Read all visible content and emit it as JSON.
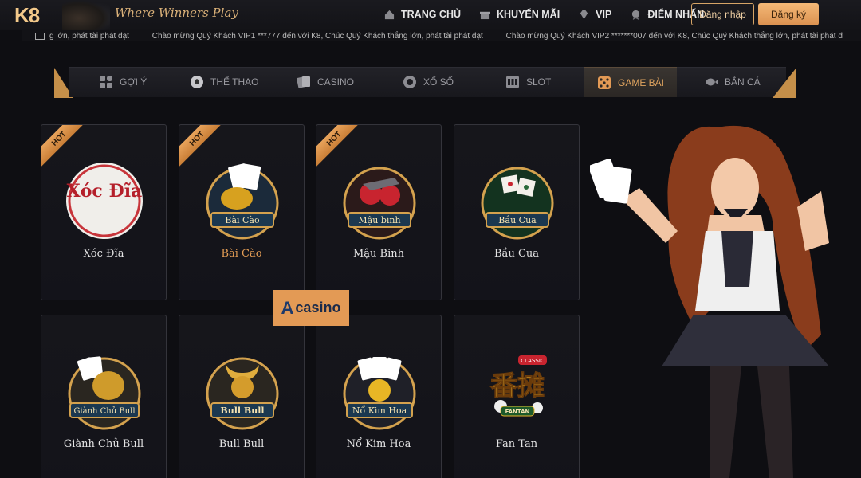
{
  "header": {
    "logo": "K8",
    "tagline": "Where Winners Play",
    "nav": [
      {
        "label": "TRANG CHỦ",
        "icon": "home-icon"
      },
      {
        "label": "KHUYẾN MÃI",
        "icon": "gift-icon"
      },
      {
        "label": "VIP",
        "icon": "diamond-icon"
      },
      {
        "label": "ĐIỂM NHẤN",
        "icon": "medal-icon"
      }
    ],
    "login_label": "Đăng nhập",
    "register_label": "Đăng ký"
  },
  "marquee": {
    "messages": [
      "g lớn, phát tài phát đạt",
      "Chào mừng Quý Khách VIP1 ***777 đến với K8, Chúc Quý Khách thắng lớn, phát tài phát đạt",
      "Chào mừng Quý Khách VIP2 *******007 đến với K8, Chúc Quý Khách thắng lớn, phát tài phát đ"
    ]
  },
  "tabs": [
    {
      "label": "GỢI Ý",
      "icon": "grid-icon"
    },
    {
      "label": "THỂ THAO",
      "icon": "soccer-ball-icon"
    },
    {
      "label": "CASINO",
      "icon": "cards-icon"
    },
    {
      "label": "XỔ SỐ",
      "icon": "lottery-ball-icon"
    },
    {
      "label": "SLOT",
      "icon": "slot-icon"
    },
    {
      "label": "GAME BÀI",
      "icon": "dice-icon",
      "active": true
    },
    {
      "label": "BẮN CÁ",
      "icon": "fish-icon"
    }
  ],
  "games": [
    {
      "name": "Xóc Đĩa",
      "hot": true,
      "art_text": "Xóc Đĩa",
      "hot_label": "HOT"
    },
    {
      "name": "Bài Cào",
      "hot": true,
      "art_text": "Bài Cào",
      "hot_label": "HOT",
      "highlight": true
    },
    {
      "name": "Mậu Binh",
      "hot": true,
      "art_text": "Mậu binh",
      "hot_label": "HOT"
    },
    {
      "name": "Bầu Cua",
      "hot": false,
      "art_text": "Bầu Cua"
    },
    {
      "name": "Giành Chủ Bull",
      "hot": false,
      "art_text": "Giành Chủ Bull"
    },
    {
      "name": "Bull Bull",
      "hot": false,
      "art_text": "Bull Bull"
    },
    {
      "name": "Nổ Kim Hoa",
      "hot": false,
      "art_text": "Nổ Kim Hoa"
    },
    {
      "name": "Fan Tan",
      "hot": false,
      "art_text": "番摊",
      "art_sub": "CLASSIC",
      "art_badge": "FANTAN"
    }
  ],
  "watermark": {
    "text": "casino"
  },
  "colors": {
    "accent": "#e39a55",
    "gold": "#d6a466",
    "bg": "#0e0e12"
  }
}
